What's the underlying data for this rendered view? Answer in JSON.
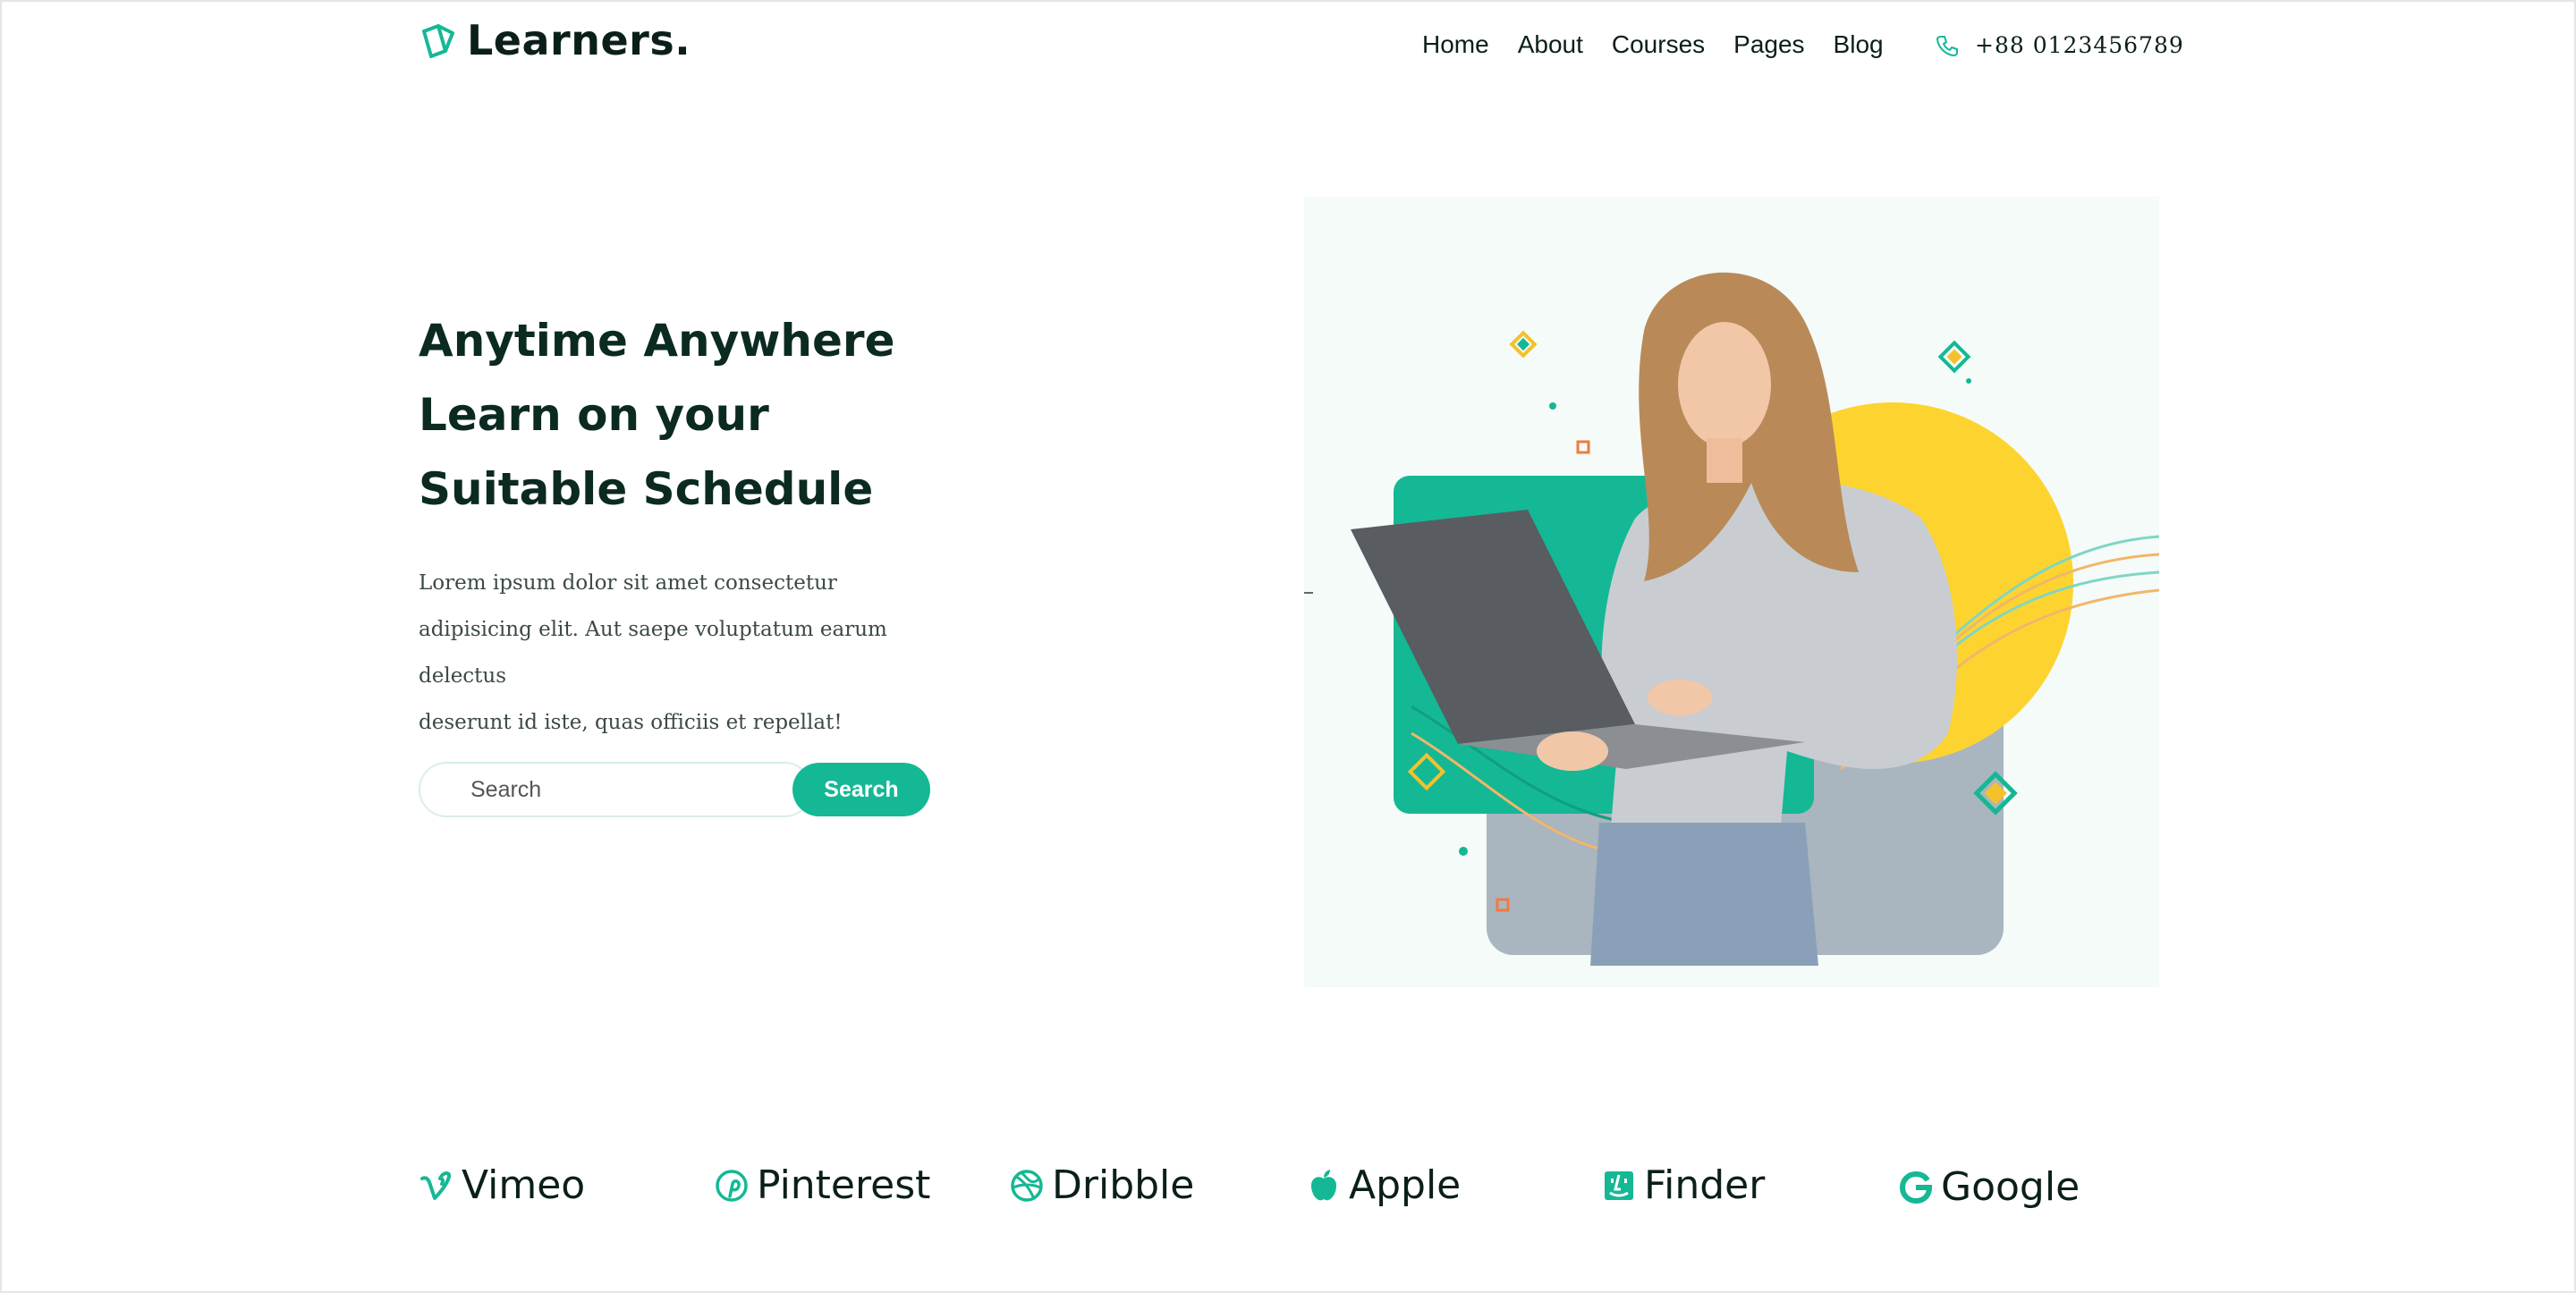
{
  "header": {
    "logo_text": "Learners.",
    "nav": [
      "Home",
      "About",
      "Courses",
      "Pages",
      "Blog"
    ],
    "phone": "+88 0123456789"
  },
  "hero": {
    "title_lines": [
      "Anytime Anywhere",
      "Learn on your",
      "Suitable Schedule"
    ],
    "description_lines": [
      "Lorem ipsum dolor sit amet consectetur",
      "adipisicing elit. Aut saepe voluptatum earum delectus",
      "deserunt id iste, quas officiis et repellat!"
    ],
    "search": {
      "placeholder": "Search",
      "button_label": "Search"
    }
  },
  "brands": [
    "Vimeo",
    "Pinterest",
    "Dribble",
    "Apple",
    "Finder",
    "Google"
  ],
  "colors": {
    "accent": "#14b894",
    "yellow": "#fdd42f",
    "text_dark": "#0b2a22"
  }
}
